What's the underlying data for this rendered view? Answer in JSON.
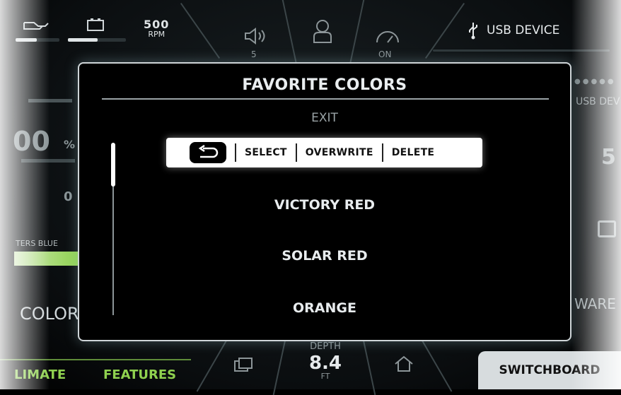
{
  "topbar": {
    "rpm_value": "500",
    "rpm_unit": "RPM",
    "volume_value": "5",
    "gauge_value": "ON",
    "usb_label": "USB DEVICE"
  },
  "background_tiles": {
    "usb_right": "USB DEV",
    "percent": "00",
    "percent_unit": "%",
    "color_name": "TERS BLUE",
    "color_label": "COLOR",
    "right_number": "5",
    "aware_label": "WARE"
  },
  "modal": {
    "title": "FAVORITE COLORS",
    "exit_label": "EXIT",
    "actions": {
      "select": "SELECT",
      "overwrite": "OVERWRITE",
      "delete": "DELETE"
    },
    "items": [
      "VICTORY RED",
      "SOLAR RED",
      "ORANGE"
    ]
  },
  "bottom": {
    "climate": "LIMATE",
    "features": "FEATURES",
    "depth_label": "DEPTH",
    "depth_value": "8.4",
    "depth_unit": "FT",
    "switchboard": "SWITCHBOARD"
  },
  "colors": {
    "accent_green": "#8fd14f",
    "panel_border": "#cfd5d8"
  }
}
